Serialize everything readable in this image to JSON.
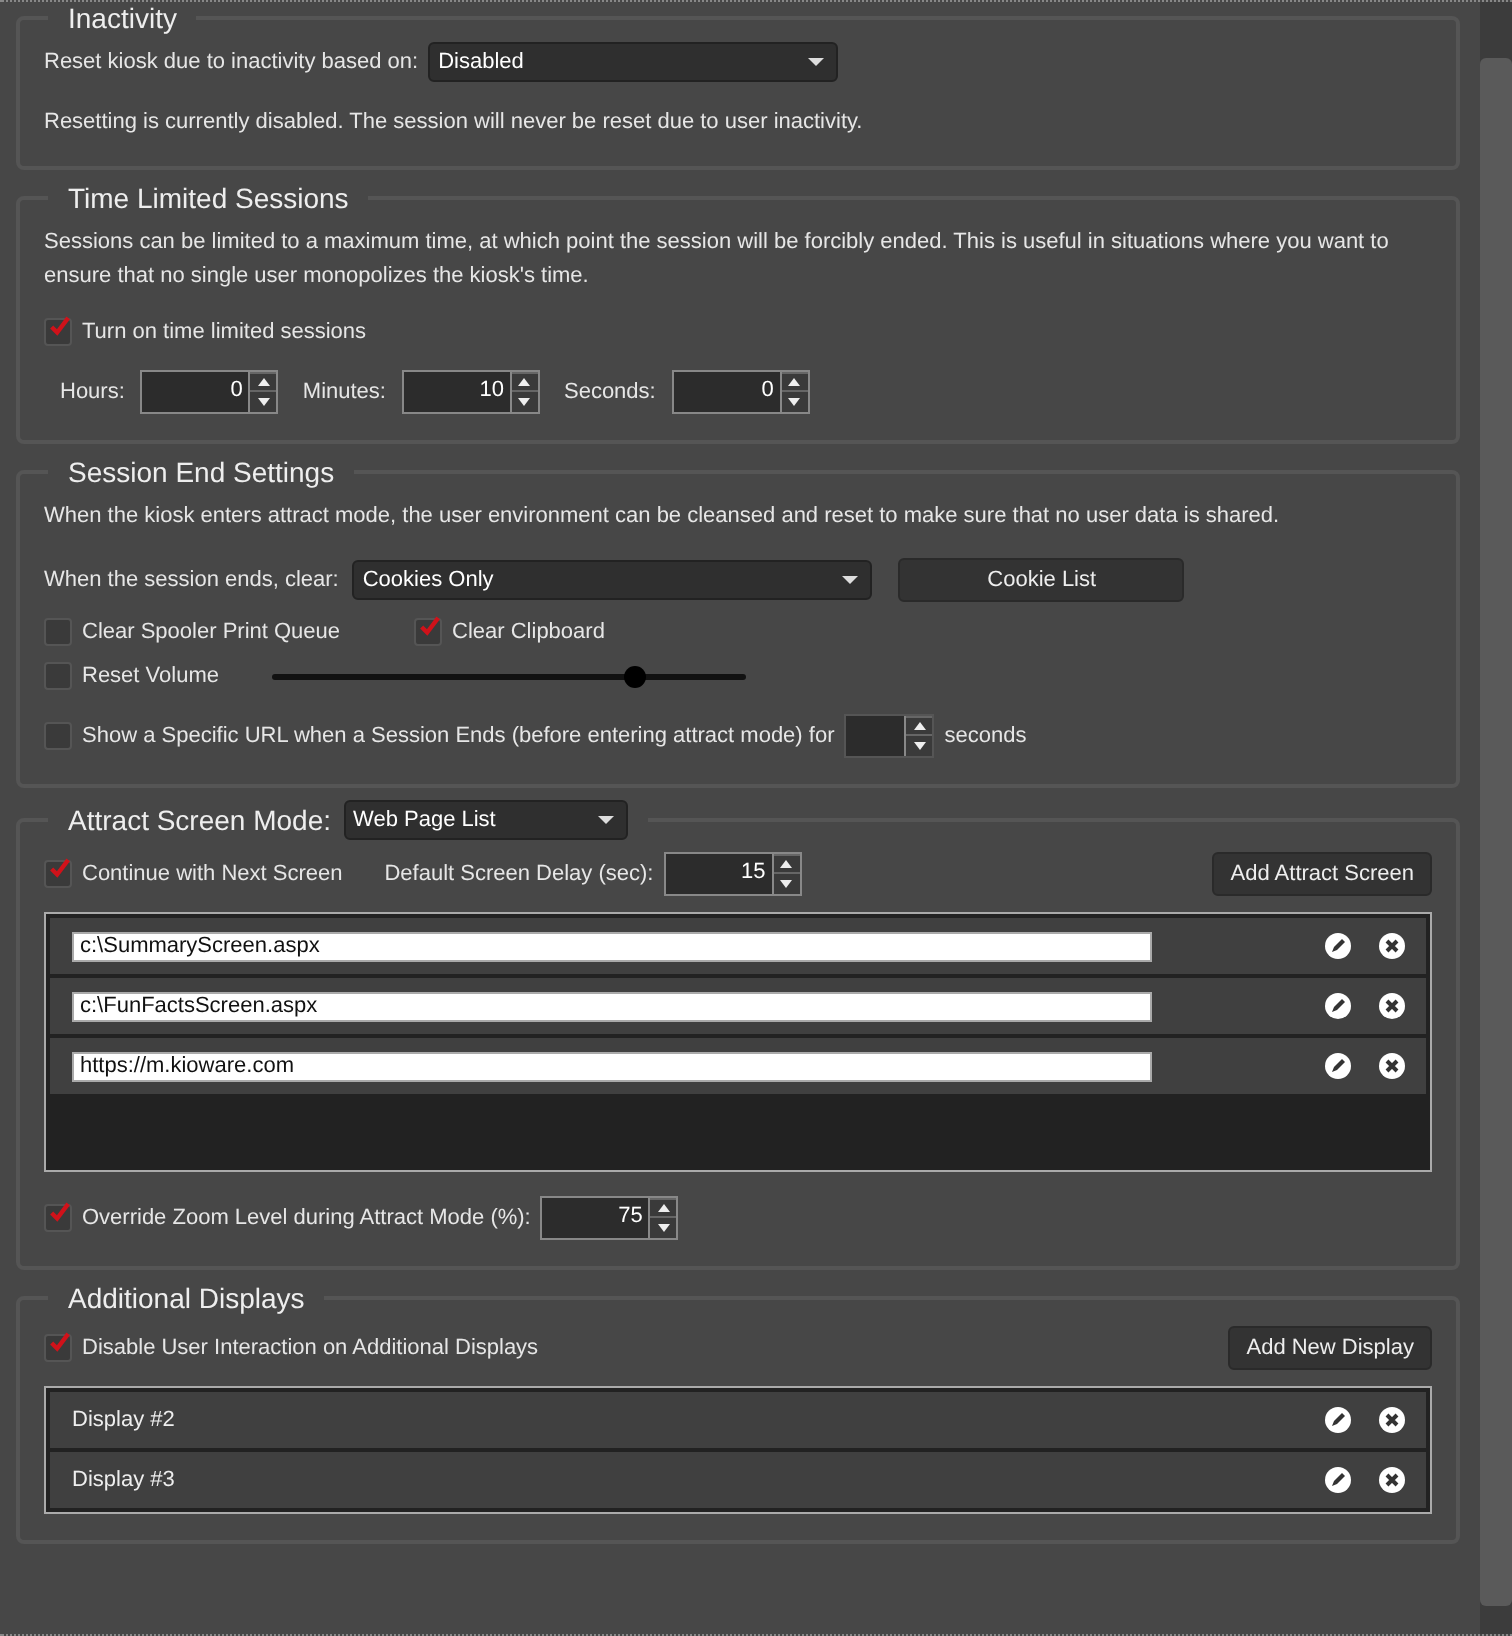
{
  "inactivity": {
    "title": "Inactivity",
    "label": "Reset kiosk due to inactivity based on:",
    "dropdown": "Disabled",
    "note": "Resetting is currently disabled. The session will never be reset due to user inactivity."
  },
  "time_limited": {
    "title": "Time Limited Sessions",
    "description": "Sessions can be limited to a maximum time, at which point the session will be forcibly ended. This is useful in situations where you want to ensure that no single user monopolizes the kiosk's time.",
    "checkbox": {
      "label": "Turn on time limited sessions",
      "checked": true
    },
    "spinners": [
      {
        "label": "Hours:",
        "value": "0"
      },
      {
        "label": "Minutes:",
        "value": "10"
      },
      {
        "label": "Seconds:",
        "value": "0"
      }
    ]
  },
  "session_end": {
    "title": "Session End Settings",
    "description": "When the kiosk enters attract mode, the user environment can be cleansed and reset to make sure that no user data is shared.",
    "clear_label": "When the session ends, clear:",
    "clear_dropdown": "Cookies Only",
    "cookie_button": "Cookie List",
    "options": [
      {
        "label": "Clear Spooler Print Queue",
        "checked": false
      },
      {
        "label": "Clear Clipboard",
        "checked": true
      }
    ],
    "reset_volume": {
      "label": "Reset Volume",
      "checked": false,
      "level": 0.76
    },
    "url_option": {
      "label": "Show a Specific URL when a Session Ends (before entering attract mode) for",
      "checked": false,
      "suffix": "seconds"
    }
  },
  "attract": {
    "title": "Attract Screen Mode:",
    "mode": "Web Page List",
    "continue": {
      "label": "Continue with Next Screen",
      "checked": true
    },
    "delay_label": "Default Screen Delay (sec):",
    "delay_value": "15",
    "add_button": "Add Attract Screen",
    "screens": [
      {
        "url": "c:\\SummaryScreen.aspx"
      },
      {
        "url": "c:\\FunFactsScreen.aspx"
      },
      {
        "url": "https://m.kioware.com"
      }
    ],
    "zoom": {
      "label": "Override Zoom Level during Attract Mode (%):",
      "checked": true,
      "value": "75"
    }
  },
  "additional": {
    "title": "Additional Displays",
    "checkbox": {
      "label": "Disable User Interaction on Additional Displays",
      "checked": true
    },
    "add_button": "Add New Display",
    "displays": [
      {
        "name": "Display #2"
      },
      {
        "name": "Display #3"
      }
    ]
  }
}
